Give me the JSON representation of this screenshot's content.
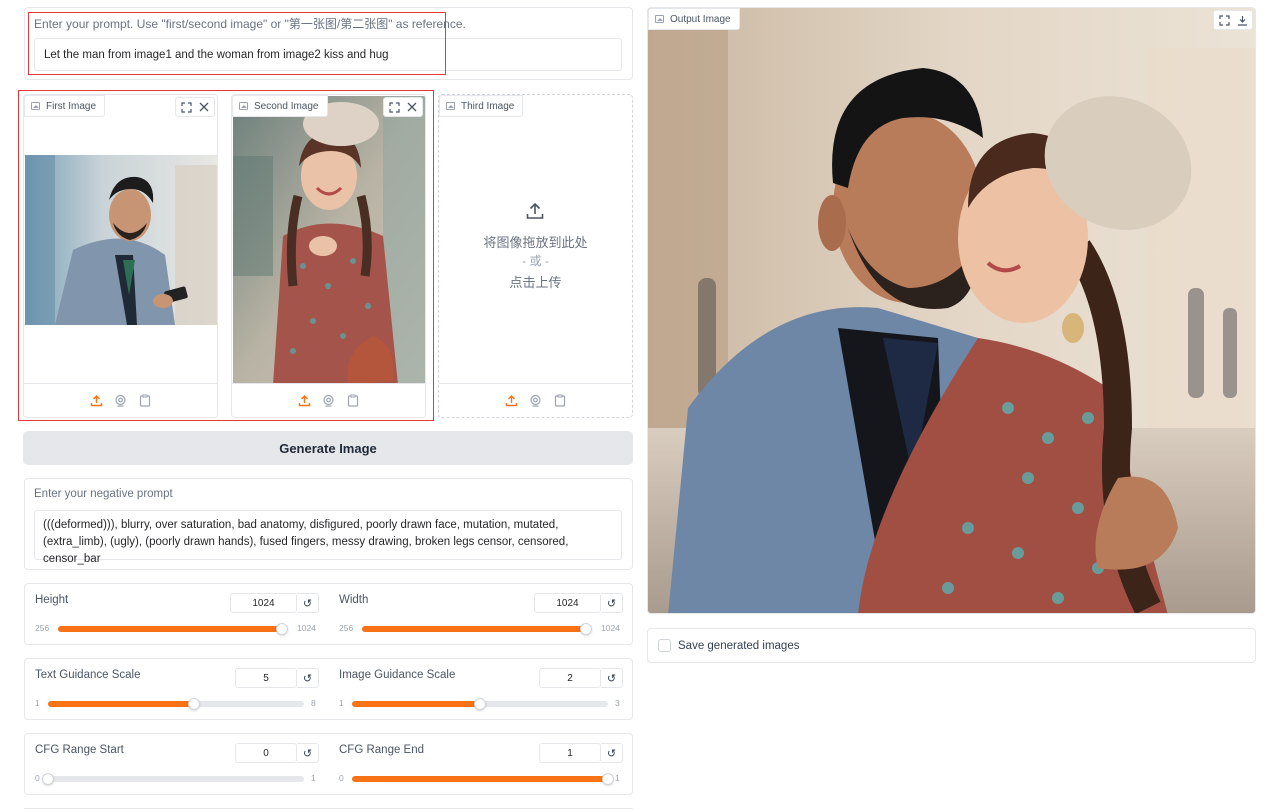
{
  "prompt": {
    "hint": "Enter your prompt. Use \"first/second image\" or \"第一张图/第二张图\" as reference.",
    "value": "Let the man from image1 and the woman from image2 kiss and hug"
  },
  "images": {
    "first": {
      "label": "First Image"
    },
    "second": {
      "label": "Second Image"
    },
    "third": {
      "label": "Third Image",
      "drop_line1": "将图像拖放到此处",
      "drop_or": "- 或 -",
      "drop_line2": "点击上传"
    }
  },
  "generate_button": "Generate Image",
  "negative_prompt": {
    "label": "Enter your negative prompt",
    "value": "(((deformed))), blurry, over saturation, bad anatomy, disfigured, poorly drawn face, mutation, mutated, (extra_limb), (ugly), (poorly drawn hands), fused fingers, messy drawing, broken legs censor, censored, censor_bar"
  },
  "sliders": {
    "height": {
      "label": "Height",
      "value": "1024",
      "min": "256",
      "max": "1024",
      "fraction": 1.0
    },
    "width": {
      "label": "Width",
      "value": "1024",
      "min": "256",
      "max": "1024",
      "fraction": 1.0
    },
    "text_guidance": {
      "label": "Text Guidance Scale",
      "value": "5",
      "min": "1",
      "max": "8",
      "fraction": 0.571
    },
    "image_guidance": {
      "label": "Image Guidance Scale",
      "value": "2",
      "min": "1",
      "max": "3",
      "fraction": 0.5
    },
    "cfg_start": {
      "label": "CFG Range Start",
      "value": "0",
      "min": "0",
      "max": "1",
      "fraction": 0.0
    },
    "cfg_end": {
      "label": "CFG Range End",
      "value": "1",
      "min": "0",
      "max": "1",
      "fraction": 1.0
    }
  },
  "output": {
    "label": "Output Image"
  },
  "save": {
    "label": "Save generated images",
    "checked": false
  },
  "colors": {
    "accent": "#f97316",
    "highlight_box": "#e53935"
  }
}
